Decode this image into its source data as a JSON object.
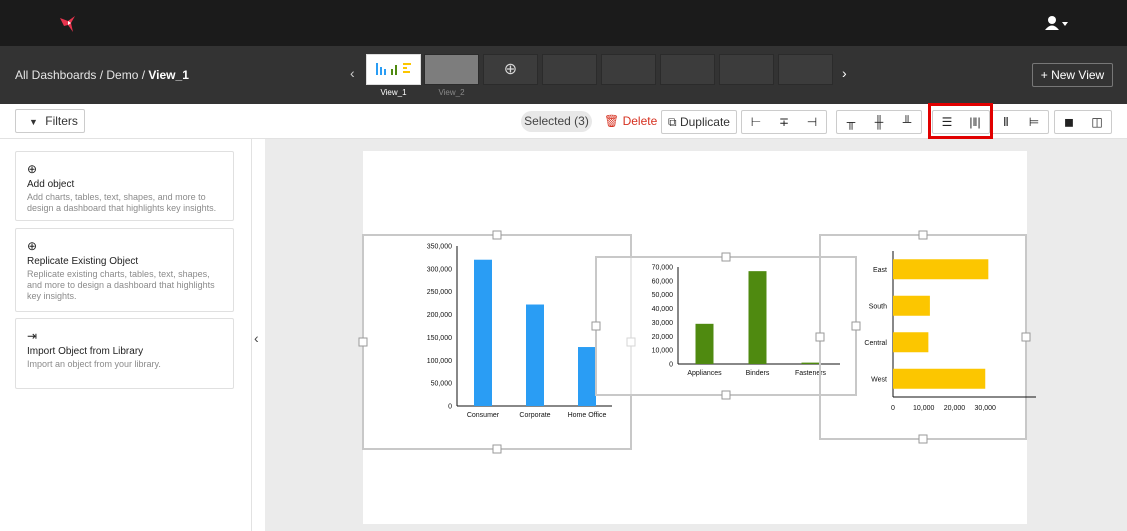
{
  "header": {
    "logo_icon": "hummingbird-logo-icon",
    "user_icon": "user-menu-icon"
  },
  "breadcrumb": {
    "path": "All Dashboards / Demo / ",
    "current": "View_1"
  },
  "views": {
    "tabs": [
      {
        "label": "View_1",
        "active": true
      },
      {
        "label": "View_2",
        "active": false
      }
    ],
    "add_icon": "plus-circle-icon",
    "new_view_label": "+ New View"
  },
  "toolbar": {
    "filters_label": "Filters",
    "selected_label": "Selected (3)",
    "delete_label": "Delete",
    "duplicate_label": "Duplicate",
    "align_horizontal": [
      "align-left-icon",
      "align-center-horizontal-icon",
      "align-right-icon"
    ],
    "align_vertical": [
      "align-top-icon",
      "align-middle-vertical-icon",
      "align-bottom-icon"
    ],
    "distribute": [
      "distribute-vertical-icon",
      "distribute-horizontal-icon"
    ],
    "match_size": [
      "match-height-icon",
      "match-width-icon"
    ],
    "order": [
      "bring-to-front-icon",
      "send-to-back-icon"
    ]
  },
  "panel": {
    "cards": [
      {
        "title": "Add object",
        "desc": "Add charts, tables, text, shapes, and more to design a dashboard that highlights key insights."
      },
      {
        "title": "Replicate Existing Object",
        "desc": "Replicate existing charts, tables, text, shapes, and more to design a dashboard that highlights key insights."
      },
      {
        "title": "Import Object from Library",
        "desc": "Import an object from your library."
      }
    ]
  },
  "chart_data": [
    {
      "type": "bar",
      "categories": [
        "Consumer",
        "Corporate",
        "Home Office"
      ],
      "values": [
        320000,
        222000,
        129000
      ],
      "ylim": [
        0,
        350000
      ],
      "yticks": [
        "0",
        "50,000",
        "100,000",
        "150,000",
        "200,000",
        "250,000",
        "300,000",
        "350,000"
      ],
      "color": "#2a9df4"
    },
    {
      "type": "bar",
      "categories": [
        "Appliances",
        "Binders",
        "Fasteners"
      ],
      "values": [
        29000,
        67000,
        1000
      ],
      "ylim": [
        0,
        70000
      ],
      "yticks": [
        "0",
        "10,000",
        "20,000",
        "30,000",
        "40,000",
        "50,000",
        "60,000",
        "70,000"
      ],
      "color": "#4f8a10"
    },
    {
      "type": "bar",
      "orientation": "horizontal",
      "categories": [
        "East",
        "South",
        "Central",
        "West"
      ],
      "values": [
        31000,
        12000,
        11500,
        30000
      ],
      "xlim": [
        0,
        40000
      ],
      "xticks": [
        "0",
        "10,000",
        "20,000",
        "30,000"
      ],
      "color": "#fcc600"
    }
  ]
}
